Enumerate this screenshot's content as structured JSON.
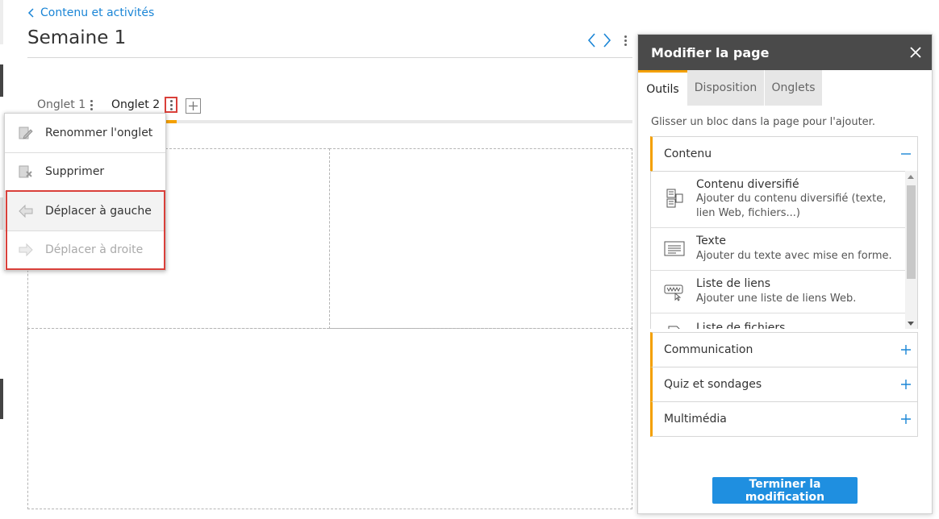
{
  "breadcrumb": {
    "label": "Contenu et activités"
  },
  "page": {
    "title": "Semaine 1"
  },
  "tabs": [
    {
      "label": "Onglet 1"
    },
    {
      "label": "Onglet 2",
      "active": true
    }
  ],
  "context_menu": {
    "items": [
      {
        "label": "Renommer l'onglet",
        "icon": "rename-icon",
        "enabled": true
      },
      {
        "label": "Supprimer",
        "icon": "delete-icon",
        "enabled": true
      },
      {
        "label": "Déplacer à gauche",
        "icon": "arrow-left-icon",
        "enabled": true
      },
      {
        "label": "Déplacer à droite",
        "icon": "arrow-right-icon",
        "enabled": false
      }
    ]
  },
  "panel": {
    "title": "Modifier la page",
    "tabs": [
      {
        "label": "Outils",
        "active": true
      },
      {
        "label": "Disposition"
      },
      {
        "label": "Onglets"
      }
    ],
    "hint": "Glisser un bloc dans la page pour l'ajouter.",
    "sections": [
      {
        "title": "Contenu",
        "expanded": true
      },
      {
        "title": "Communication"
      },
      {
        "title": "Quiz et sondages"
      },
      {
        "title": "Multimédia"
      }
    ],
    "blocks": [
      {
        "name": "Contenu diversifié",
        "desc": "Ajouter du contenu diversifié (texte, lien Web, fichiers...)",
        "icon": "mixed-content-icon"
      },
      {
        "name": "Texte",
        "desc": "Ajouter du texte avec mise en forme.",
        "icon": "text-icon"
      },
      {
        "name": "Liste de liens",
        "desc": "Ajouter une liste de liens Web.",
        "icon": "link-list-icon"
      },
      {
        "name": "Liste de fichiers",
        "desc": "",
        "icon": "file-list-icon"
      }
    ],
    "finish_label": "Terminer la modification"
  },
  "colors": {
    "accent": "#f4a000",
    "link": "#1a85d6",
    "primary_button": "#1f8fe0",
    "panel_header": "#4a4a4a",
    "highlight": "#d9403a"
  }
}
